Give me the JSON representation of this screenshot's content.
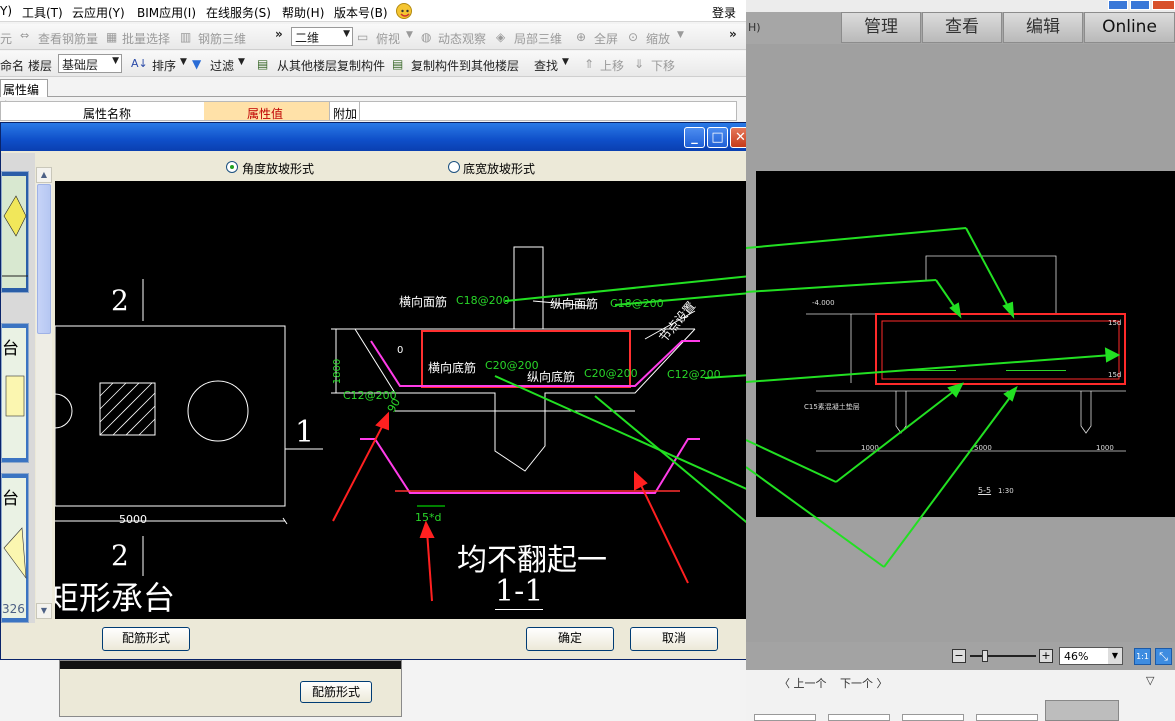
{
  "menu": {
    "items": [
      "Y)",
      "工具(T)",
      "云应用(Y)",
      "BIM应用(I)",
      "在线服务(S)",
      "帮助(H)",
      "版本号(B)"
    ],
    "login": "登录"
  },
  "toolbar1": {
    "yuan": "元",
    "view_rebar": "查看钢筋量",
    "batch_select": "批量选择",
    "rebar_3d": "钢筋三维",
    "more": "»",
    "view_mode": "二维",
    "top_view": "俯视",
    "dynamic_view": "动态观察",
    "local_3d": "局部三维",
    "fullscreen": "全屏",
    "zoom": "缩放",
    "more_right": "»"
  },
  "toolbar2": {
    "rename": "命名",
    "floor_label": "楼层",
    "floor_value": "基础层",
    "sort": "排序",
    "filter": "过滤",
    "copy_from_floor": "从其他楼层复制构件",
    "copy_to_floor": "复制构件到其他楼层",
    "find": "查找",
    "move_up": "上移",
    "move_down": "下移"
  },
  "property_tab": "属性编辑",
  "property_grid": {
    "col_name": "属性名称",
    "col_value": "属性值",
    "col_extra": "附加"
  },
  "dialog": {
    "radio_angle": "角度放坡形式",
    "radio_width": "底宽放坡形式",
    "btn_rebar_form": "配筋形式",
    "btn_ok": "确定",
    "btn_cancel": "取消",
    "thumb_label_1": "台",
    "thumb_label_2": "台",
    "thumb_num": "326"
  },
  "cad": {
    "label_2_top": "2",
    "label_1": "1",
    "label_2_bottom": "2",
    "dim_5000": "5000",
    "title": "矩形承台",
    "h_top_rebar": "横向面筋",
    "h_top_spec": "C18@200",
    "v_top_rebar": "纵向面筋",
    "v_top_spec": "C18@200",
    "h_bottom_rebar": "横向底筋",
    "h_bottom_spec": "C20@200",
    "v_bottom_rebar": "纵向底筋",
    "v_bottom_spec": "C20@200",
    "side_spec_right": "C12@200",
    "side_spec_left": "C12@200",
    "node_setting": "节点设置",
    "dim_1800": "1800",
    "dim_0": "0",
    "angle_90": "90",
    "anchor_15d": "15*d",
    "note": "均不翻起一",
    "section": "1-1"
  },
  "subpanel": {
    "btn_rebar_form": "配筋形式"
  },
  "viewer": {
    "left_char": "H)",
    "tabs": [
      "管理",
      "查看",
      "编辑",
      "Online"
    ],
    "zoom_value": "46%",
    "prev": "〈 上一个",
    "next": "下一个 〉"
  },
  "drawing": {
    "dim_4000": "-4.000",
    "dim_1000a": "1000",
    "dim_1000b": "1000",
    "dim_5000b": "5000",
    "concrete_note": "C15素混凝土垫层",
    "section_ref": "5-5",
    "scale": "1:30",
    "s1": "15d",
    "s2": "15d"
  }
}
